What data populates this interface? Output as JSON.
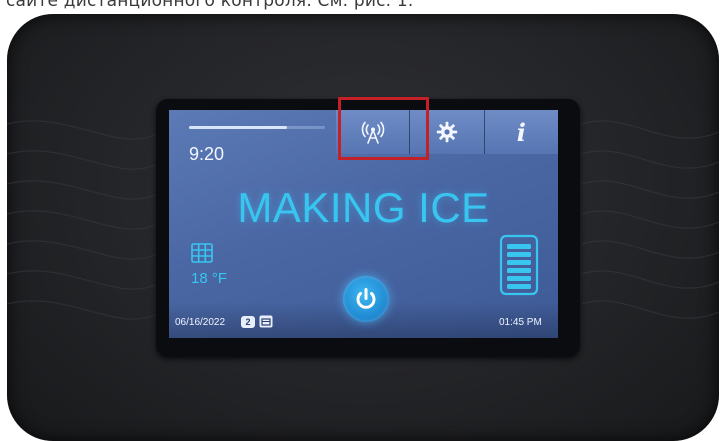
{
  "caption": "сайте дистанционного контроля. См. рис. 1.",
  "screen": {
    "progress_fraction": 0.72,
    "clock": "9:20",
    "tabs": [
      {
        "icon": "signal-tower-icon"
      },
      {
        "icon": "gear-icon"
      },
      {
        "icon": "info-icon",
        "label": "i"
      }
    ],
    "status": "MAKING ICE",
    "mode_icon": "grid-icon",
    "temperature": "18 °F",
    "bin_icon": "ice-bin-level-icon",
    "power_icon": "power-icon",
    "date": "06/16/2022",
    "badge": "2",
    "calendar_icon": "calendar-icon",
    "time": "01:45 PM"
  },
  "colors": {
    "accent": "#38c6f0",
    "highlight": "#c32027",
    "screen_bg": "#4a67a4"
  }
}
